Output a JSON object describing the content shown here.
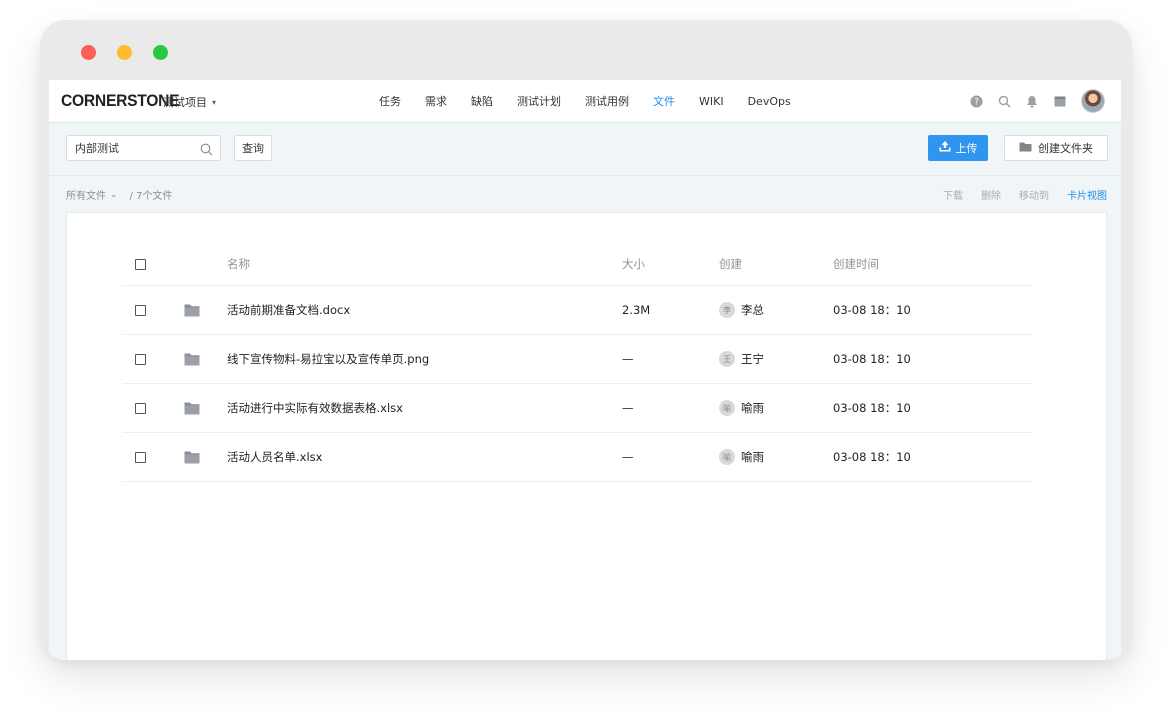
{
  "window": {
    "colors": {
      "close": "#fe5f57",
      "minimize": "#febc2e",
      "maximize": "#28c840"
    }
  },
  "topnav": {
    "logo": "CORNERSTONE",
    "project": "测试项目",
    "links": [
      {
        "label": "任务",
        "active": false
      },
      {
        "label": "需求",
        "active": false
      },
      {
        "label": "缺陷",
        "active": false
      },
      {
        "label": "测试计划",
        "active": false
      },
      {
        "label": "测试用例",
        "active": false
      },
      {
        "label": "文件",
        "active": true
      },
      {
        "label": "WIKI",
        "active": false
      },
      {
        "label": "DevOps",
        "active": false
      }
    ],
    "icons": [
      "help-icon",
      "search-icon",
      "bell-icon",
      "calendar-icon",
      "avatar"
    ],
    "accent": "#1f8ee8"
  },
  "toolbar": {
    "search_value": "内部测试",
    "query_label": "查询",
    "upload_label": "上传",
    "create_folder_label": "创建文件夹",
    "upload_color": "#2f95ee"
  },
  "pathbar": {
    "all_files": "所有文件",
    "count": "/ 7个文件",
    "actions": [
      {
        "label": "下载",
        "active": false
      },
      {
        "label": "删除",
        "active": false
      },
      {
        "label": "移动到",
        "active": false
      },
      {
        "label": "卡片视图",
        "active": true
      }
    ]
  },
  "table": {
    "headers": {
      "name": "名称",
      "size": "大小",
      "creator": "创建",
      "time": "创建时间"
    },
    "rows": [
      {
        "name": "活动前期准备文档.docx",
        "size": "2.3M",
        "creator": "李总",
        "creator_initial": "李",
        "time": "03-08 18：10"
      },
      {
        "name": "线下宣传物料-易拉宝以及宣传单页.png",
        "size": "—",
        "creator": "王宁",
        "creator_initial": "王",
        "time": "03-08 18：10"
      },
      {
        "name": "活动进行中实际有效数据表格.xlsx",
        "size": "—",
        "creator": "喻雨",
        "creator_initial": "喻",
        "time": "03-08 18：10"
      },
      {
        "name": "活动人员名单.xlsx",
        "size": "—",
        "creator": "喻雨",
        "creator_initial": "喻",
        "time": "03-08 18：10"
      }
    ]
  }
}
